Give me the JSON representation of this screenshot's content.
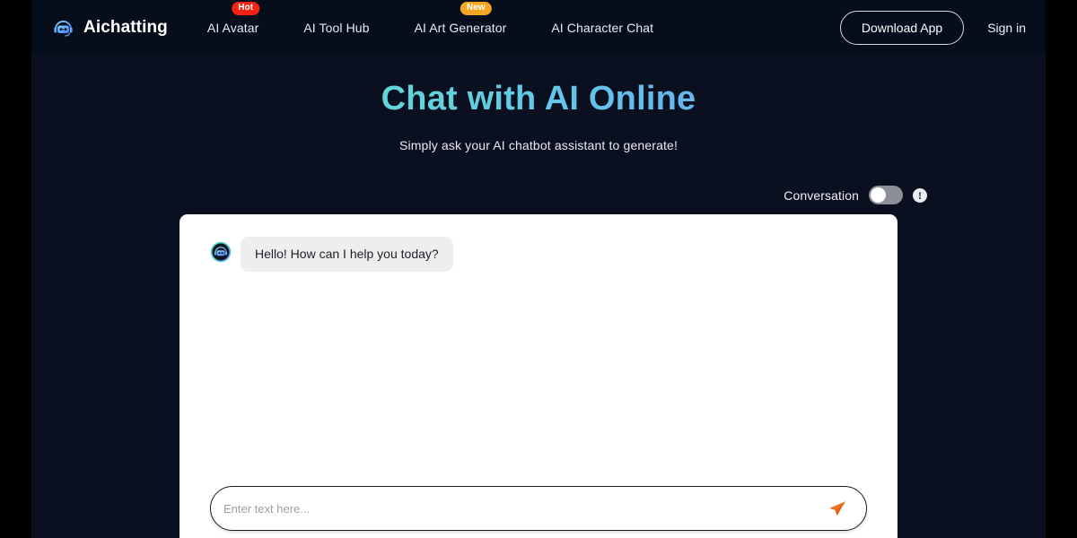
{
  "header": {
    "brand": {
      "name": "Aichatting",
      "logo_icon": "chatbot-headset-icon"
    },
    "nav": [
      {
        "label": "AI Avatar",
        "badge": "Hot",
        "badge_color": "#f52314"
      },
      {
        "label": "AI Tool Hub",
        "badge": "",
        "badge_color": ""
      },
      {
        "label": "AI Art Generator",
        "badge": "New",
        "badge_color": "#f5a623"
      },
      {
        "label": "AI Character Chat",
        "badge": "",
        "badge_color": ""
      }
    ],
    "download_label": "Download App",
    "signin_label": "Sign in"
  },
  "hero": {
    "title": "Chat with AI Online",
    "subtitle": "Simply ask your AI chatbot assistant to generate!",
    "gradient_from": "#5de3d0",
    "gradient_to": "#7e8df5"
  },
  "conversation": {
    "label": "Conversation",
    "toggle_state": "off",
    "info_glyph": "!",
    "info_icon": "info-exclamation-icon"
  },
  "chat": {
    "messages": [
      {
        "sender": "assistant",
        "avatar_icon": "robot-avatar-icon",
        "text": "Hello! How can I help you today?"
      }
    ],
    "input_placeholder": "Enter text here...",
    "input_value": "",
    "send_icon": "send-paper-plane-icon",
    "send_color": "#ee7623"
  }
}
